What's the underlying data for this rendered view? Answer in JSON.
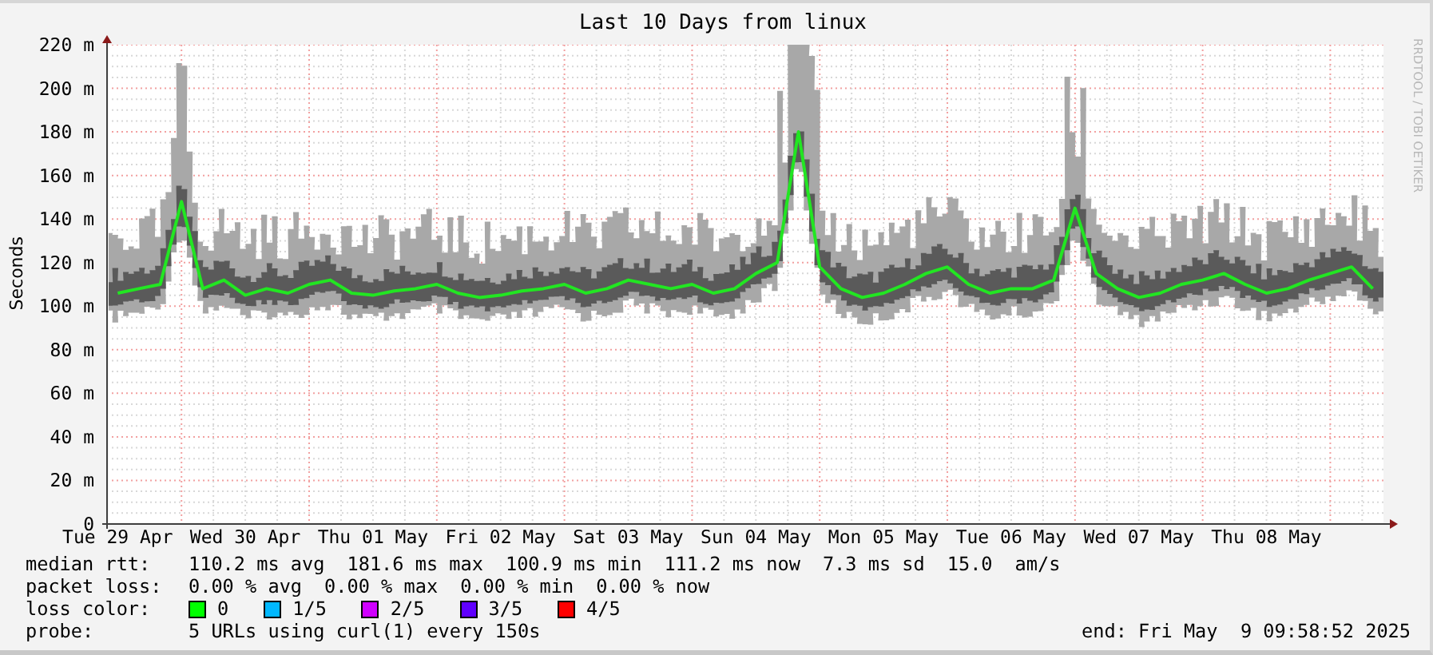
{
  "title": "Last 10 Days from linux",
  "credit": "RRDTOOL / TOBI OETIKER",
  "chart": {
    "chart_data": {
      "type": "line",
      "ylabel": "Seconds",
      "ylim": [
        0,
        220
      ],
      "yticks": [
        {
          "value": 0,
          "label": "0"
        },
        {
          "value": 20,
          "label": "20 m"
        },
        {
          "value": 40,
          "label": "40 m"
        },
        {
          "value": 60,
          "label": "60 m"
        },
        {
          "value": 80,
          "label": "80 m"
        },
        {
          "value": 100,
          "label": "100 m"
        },
        {
          "value": 120,
          "label": "120 m"
        },
        {
          "value": 140,
          "label": "140 m"
        },
        {
          "value": 160,
          "label": "160 m"
        },
        {
          "value": 180,
          "label": "180 m"
        },
        {
          "value": 200,
          "label": "200 m"
        },
        {
          "value": 220,
          "label": "220 m"
        }
      ],
      "categories": [
        "Tue 29 Apr",
        null,
        null,
        null,
        null,
        null,
        "Wed 30 Apr",
        null,
        null,
        null,
        null,
        null,
        "Thu 01 May",
        null,
        null,
        null,
        null,
        null,
        "Fri 02 May",
        null,
        null,
        null,
        null,
        null,
        "Sat 03 May",
        null,
        null,
        null,
        null,
        null,
        "Sun 04 May",
        null,
        null,
        null,
        null,
        null,
        "Mon 05 May",
        null,
        null,
        null,
        null,
        null,
        "Tue 06 May",
        null,
        null,
        null,
        null,
        null,
        "Wed 07 May",
        null,
        null,
        null,
        null,
        null,
        "Thu 08 May",
        null,
        null,
        null,
        null,
        null
      ],
      "grid": true,
      "series": [
        {
          "name": "median rtt:",
          "color": "#22e622",
          "values": [
            106,
            108,
            110,
            148,
            108,
            112,
            105,
            108,
            106,
            110,
            112,
            106,
            105,
            107,
            108,
            110,
            106,
            104,
            105,
            107,
            108,
            110,
            106,
            108,
            112,
            110,
            108,
            110,
            106,
            108,
            115,
            120,
            180,
            118,
            108,
            104,
            106,
            110,
            115,
            118,
            110,
            106,
            108,
            108,
            112,
            145,
            115,
            108,
            104,
            106,
            110,
            112,
            115,
            110,
            106,
            108,
            112,
            115,
            118,
            108
          ]
        }
      ]
    }
  },
  "legend": {
    "rows": [
      {
        "kind": "values",
        "items": [
          "110.2 ms avg",
          "181.6 ms max",
          "100.9 ms min",
          "111.2 ms now",
          "7.3 ms sd",
          "15.0",
          "am/s"
        ]
      },
      {
        "kind": "values",
        "label": "packet loss:",
        "items": [
          "0.00 % avg",
          "0.00 % max",
          "0.00 % min",
          "0.00 % now"
        ]
      },
      {
        "kind": "colors",
        "label": "loss color:",
        "items": [
          {
            "label": "0",
            "color": "#00ff00"
          },
          {
            "label": "1/5",
            "color": "#00b8ff"
          },
          {
            "label": "2/5",
            "color": "#d000ff"
          },
          {
            "label": "3/5",
            "color": "#6000ff"
          },
          {
            "label": "4/5",
            "color": "#ff0000"
          }
        ]
      },
      {
        "kind": "probe",
        "label": "probe:",
        "text": "5 URLs using curl(1) every 150s",
        "end": "end: Fri May  9 09:58:52 2025"
      }
    ]
  }
}
